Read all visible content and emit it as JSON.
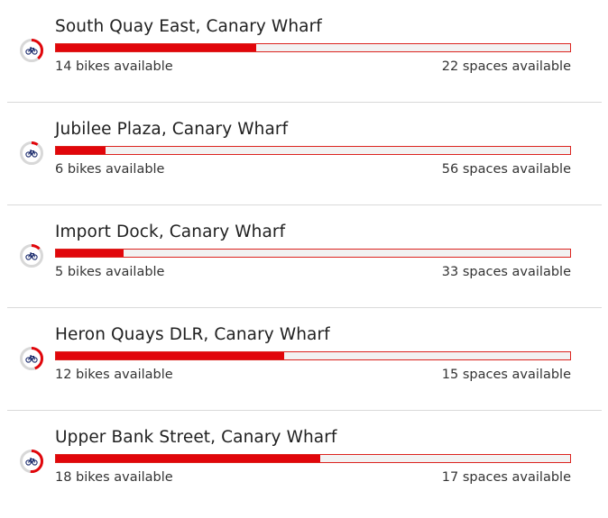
{
  "brand_color": "#e1060b",
  "icon": "bicycle-icon",
  "stations": [
    {
      "name": "South Quay East, Canary Wharf",
      "bikes_text": "14 bikes available",
      "spaces_text": "22 spaces available",
      "bikes": 14,
      "spaces": 22
    },
    {
      "name": "Jubilee Plaza, Canary Wharf",
      "bikes_text": "6 bikes available",
      "spaces_text": "56 spaces available",
      "bikes": 6,
      "spaces": 56
    },
    {
      "name": "Import Dock, Canary Wharf",
      "bikes_text": "5 bikes available",
      "spaces_text": "33 spaces available",
      "bikes": 5,
      "spaces": 33
    },
    {
      "name": "Heron Quays DLR, Canary Wharf",
      "bikes_text": "12 bikes available",
      "spaces_text": "15 spaces available",
      "bikes": 12,
      "spaces": 15
    },
    {
      "name": "Upper Bank Street, Canary Wharf",
      "bikes_text": "18 bikes available",
      "spaces_text": "17 spaces available",
      "bikes": 18,
      "spaces": 17
    }
  ]
}
